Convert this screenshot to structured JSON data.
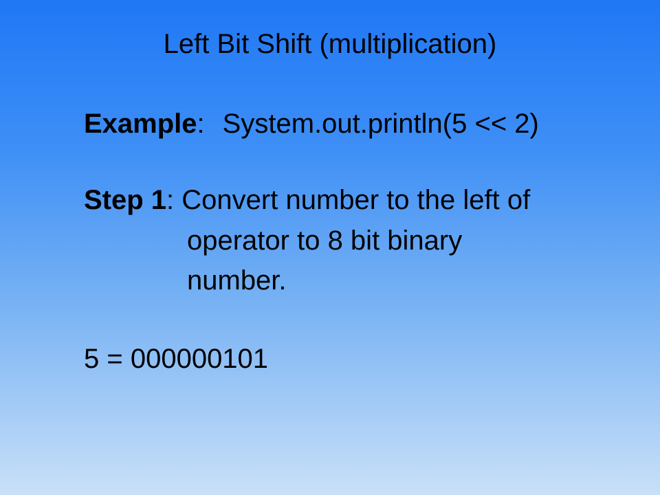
{
  "slide": {
    "title": "Left Bit Shift (multiplication)",
    "example": {
      "label": "Example",
      "separator": ":",
      "code": "System.out.println(5 << 2)"
    },
    "step1": {
      "label": "Step 1",
      "separator": ":",
      "lines": [
        " Convert number to the left of",
        "operator to 8 bit binary",
        "number."
      ]
    },
    "result": "5 = 000000101"
  },
  "colors": {
    "background_top": "#1f77f5",
    "background_bottom": "#c9e0f8",
    "text": "#000000"
  }
}
